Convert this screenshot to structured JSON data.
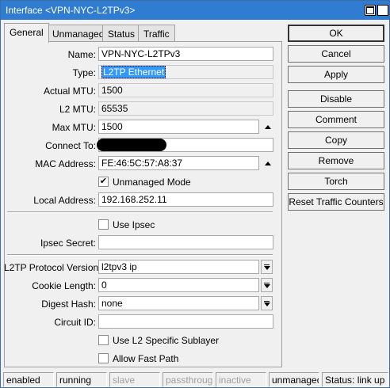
{
  "window": {
    "title": "Interface <VPN-NYC-L2TPv3>",
    "close_glyph": "✕"
  },
  "tabs": [
    "General",
    "Unmanaged",
    "Status",
    "Traffic"
  ],
  "form": {
    "name": {
      "label": "Name:",
      "value": "VPN-NYC-L2TPv3"
    },
    "type": {
      "label": "Type:",
      "value": "L2TP Ethernet"
    },
    "actual_mtu": {
      "label": "Actual MTU:",
      "value": "1500"
    },
    "l2_mtu": {
      "label": "L2 MTU:",
      "value": "65535"
    },
    "max_mtu": {
      "label": "Max MTU:",
      "value": "1500"
    },
    "connect_to": {
      "label": "Connect To:",
      "value": ""
    },
    "mac_address": {
      "label": "MAC Address:",
      "value": "FE:46:5C:57:A8:37"
    },
    "unmanaged_mode": {
      "label": "Unmanaged Mode",
      "checked": true,
      "check_glyph": "✔"
    },
    "local_address": {
      "label": "Local Address:",
      "value": "192.168.252.11"
    },
    "use_ipsec": {
      "label": "Use Ipsec",
      "checked": false
    },
    "ipsec_secret": {
      "label": "Ipsec Secret:",
      "value": ""
    },
    "l2tp_protocol_version": {
      "label": "L2TP Protocol Version:",
      "value": "l2tpv3 ip"
    },
    "cookie_length": {
      "label": "Cookie Length:",
      "value": "0"
    },
    "digest_hash": {
      "label": "Digest Hash:",
      "value": "none"
    },
    "circuit_id": {
      "label": "Circuit ID:",
      "value": ""
    },
    "use_l2_specific_sublayer": {
      "label": "Use L2 Specific Sublayer",
      "checked": false
    },
    "allow_fast_path": {
      "label": "Allow Fast Path",
      "checked": false
    }
  },
  "buttons": {
    "ok": "OK",
    "cancel": "Cancel",
    "apply": "Apply",
    "disable": "Disable",
    "comment": "Comment",
    "copy": "Copy",
    "remove": "Remove",
    "torch": "Torch",
    "reset_traffic_counters": "Reset Traffic Counters"
  },
  "statusbar": {
    "enabled": "enabled",
    "running": "running",
    "slave": "slave",
    "passthrough": "passthrough",
    "inactive": "inactive",
    "unmanaged": "unmanaged",
    "status": "Status: link up"
  },
  "colors": {
    "titlebar": "#2f7cd0",
    "selection": "#3399ff",
    "disabled_text": "#a0a0a0"
  }
}
